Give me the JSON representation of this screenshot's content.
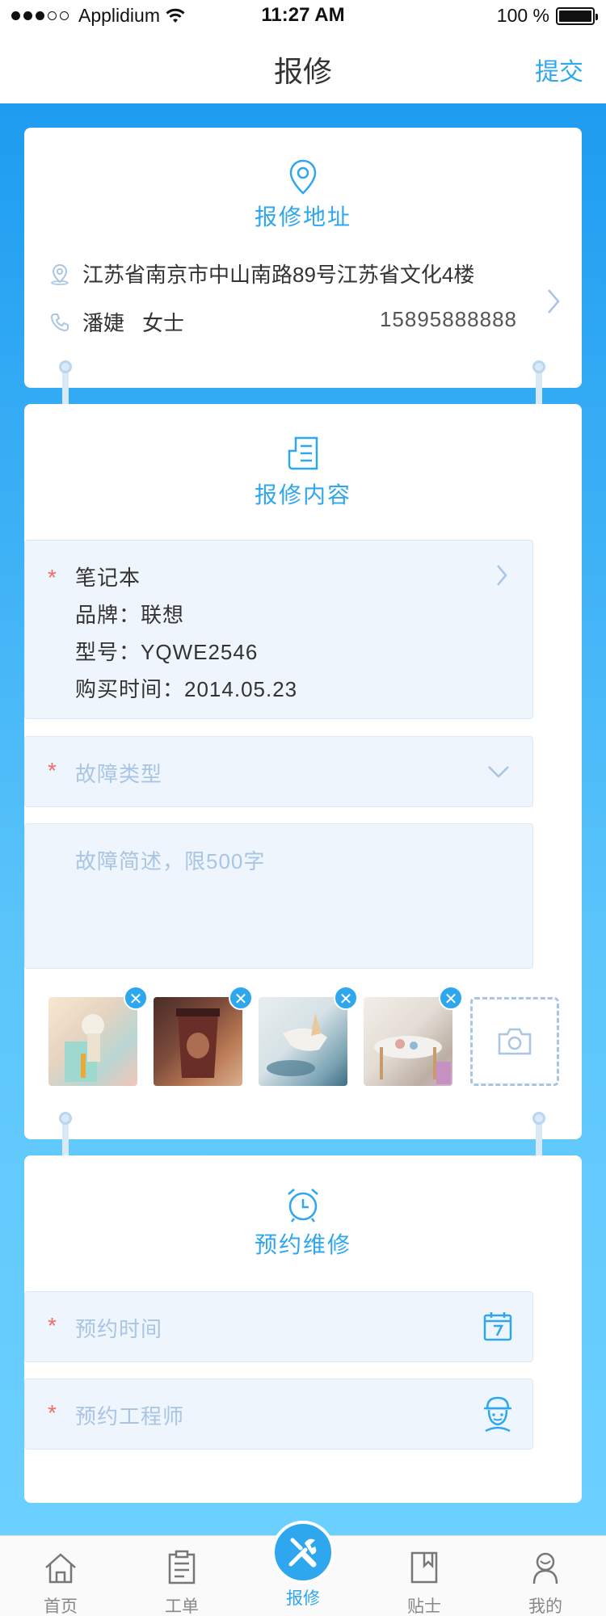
{
  "status_bar": {
    "carrier": "Applidium",
    "time": "11:27 AM",
    "battery": "100 %"
  },
  "nav": {
    "title": "报修",
    "submit": "提交"
  },
  "address_section": {
    "title": "报修地址",
    "address": "江苏省南京市中山南路89号江苏省文化4楼",
    "contact_name": "潘婕",
    "contact_title": "女士",
    "phone": "15895888888"
  },
  "content_section": {
    "title": "报修内容",
    "device": {
      "name": "笔记本",
      "brand": "品牌：联想",
      "model": "型号：YQWE2546",
      "purchase": "购买时间：2014.05.23"
    },
    "fault_type_placeholder": "故障类型",
    "description_placeholder": "故障简述，限500字",
    "photos": [
      "photo-1",
      "photo-2",
      "photo-3",
      "photo-4"
    ]
  },
  "appointment_section": {
    "title": "预约维修",
    "time_placeholder": "预约时间",
    "engineer_placeholder": "预约工程师"
  },
  "tabs": [
    {
      "label": "首页",
      "icon": "home-icon"
    },
    {
      "label": "工单",
      "icon": "clipboard-icon"
    },
    {
      "label": "报修",
      "icon": "tools-icon"
    },
    {
      "label": "贴士",
      "icon": "bookmark-icon"
    },
    {
      "label": "我的",
      "icon": "user-icon"
    }
  ],
  "colors": {
    "accent": "#2ea7ee",
    "required": "#f46a66",
    "placeholder": "#a8c5e4"
  }
}
